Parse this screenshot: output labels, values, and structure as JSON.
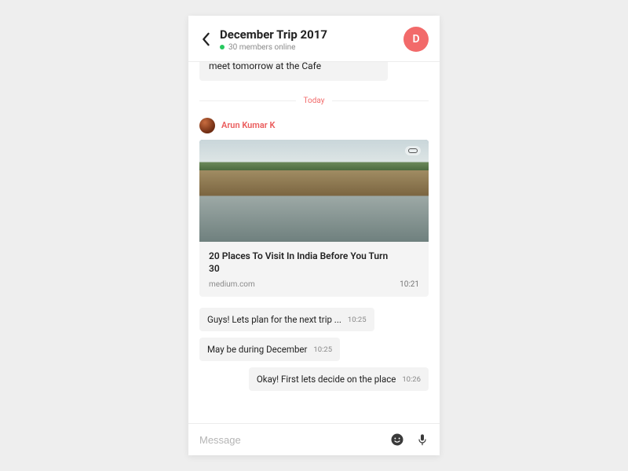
{
  "header": {
    "title": "December Trip 2017",
    "members_online": "30 members online",
    "avatar_initial": "D"
  },
  "separator_label": "Today",
  "truncated_message": "meet tomorrow at the Cafe",
  "sender": {
    "name": "Arun Kumar K"
  },
  "link_card": {
    "title": "20 Places To Visit In India Before You Turn 30",
    "source": "medium.com",
    "time": "10:21"
  },
  "messages": [
    {
      "side": "left",
      "text": "Guys! Lets plan for the next trip ...",
      "time": "10:25"
    },
    {
      "side": "left",
      "text": "May be during December",
      "time": "10:25"
    },
    {
      "side": "right",
      "text": "Okay! First lets decide on the place",
      "time": "10:26"
    }
  ],
  "composer": {
    "placeholder": "Message"
  }
}
